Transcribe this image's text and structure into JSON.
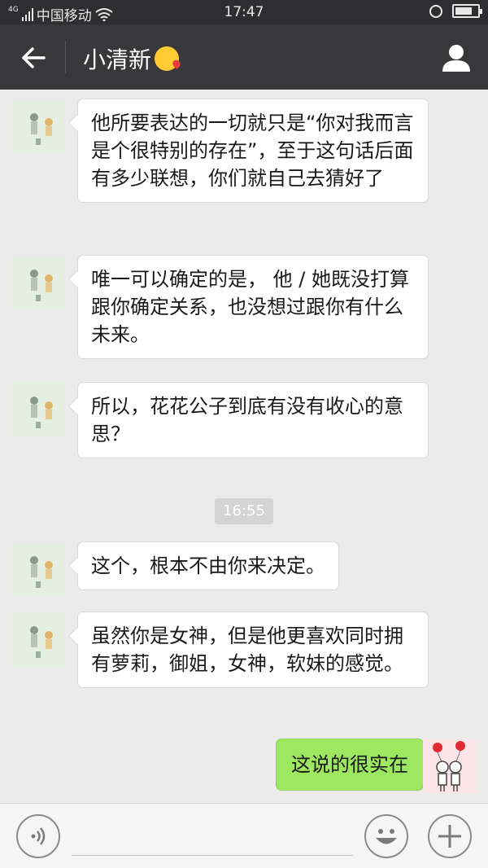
{
  "status_bar": {
    "network": "4G",
    "carrier": "中国移动",
    "time": "17:47"
  },
  "header": {
    "title": "小清新",
    "title_emoji": "kissing-face-emoji"
  },
  "messages": [
    {
      "sender": "contact",
      "text": "他所要表达的一切就只是“你对我而言是个很特别的存在”，至于这句话后面有多少联想，你们就自己去猜好了"
    },
    {
      "sender": "contact",
      "text": "唯一可以确定的是， 他 / 她既没打算跟你确定关系，也没想过跟你有什么未来。"
    },
    {
      "sender": "contact",
      "text": "所以，花花公子到底有没有收心的意思？"
    },
    {
      "sender": "contact",
      "text": "这个，根本不由你来决定。"
    },
    {
      "sender": "contact",
      "text": "虽然你是女神，但是他更喜欢同时拥有萝莉，御姐，女神，软妹的感觉。"
    },
    {
      "sender": "me",
      "text": "这说的很实在"
    }
  ],
  "timestamp_divider": "16:55",
  "input_bar": {
    "text_value": ""
  },
  "colors": {
    "status_bg": "#2e2e31",
    "nav_bg": "#38383b",
    "chat_bg": "#ebebeb",
    "my_bubble": "#9ee861",
    "contact_bubble": "#ffffff"
  }
}
